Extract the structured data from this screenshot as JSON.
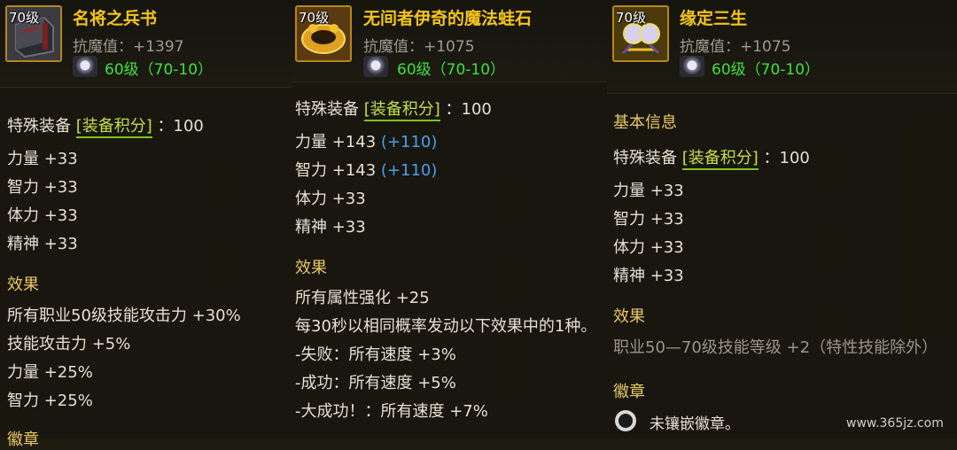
{
  "panels": [
    {
      "level": "70级",
      "title": "名将之兵书",
      "resist": "抗魔值：+1397",
      "requirement": "60级（70-10）",
      "special_label": "特殊装备",
      "score_label": "[装备积分]",
      "score_value": "：100",
      "stats": [
        "力量 +33",
        "智力 +33",
        "体力 +33",
        "精神 +33"
      ],
      "effects_heading": "效果",
      "effects": [
        "所有职业50级技能攻击力 +30%",
        "技能攻击力 +5%",
        "力量 +25%",
        "智力 +25%"
      ],
      "emblem_heading": "徽章"
    },
    {
      "level": "70级",
      "title": "无间者伊奇的魔法蛙石",
      "resist": "抗魔值：+1075",
      "requirement": "60级（70-10）",
      "special_label": "特殊装备",
      "score_label": "[装备积分]",
      "score_value": "：100",
      "stats": [
        {
          "text": "力量 +143",
          "bonus": "(+110)"
        },
        {
          "text": "智力 +143",
          "bonus": "(+110)"
        },
        {
          "text": "体力 +33",
          "bonus": ""
        },
        {
          "text": "精神 +33",
          "bonus": ""
        }
      ],
      "effects_heading": "效果",
      "effects": [
        "所有属性强化 +25",
        "每30秒以相同概率发动以下效果中的1种。",
        "-失败：所有速度 +3%",
        "-成功：所有速度 +5%",
        "-大成功！：所有速度 +7%"
      ]
    },
    {
      "level": "70级",
      "title": "缘定三生",
      "resist": "抗魔值：+1075",
      "requirement": "60级（70-10）",
      "basic_info": "基本信息",
      "special_label": "特殊装备",
      "score_label": "[装备积分]",
      "score_value": "：100",
      "stats": [
        "力量 +33",
        "智力 +33",
        "体力 +33",
        "精神 +33"
      ],
      "effects_heading": "效果",
      "effects": [
        "职业50—70级技能等级 +2（特性技能除外）"
      ],
      "emblem_heading": "徽章",
      "emblem_text": "未镶嵌徽章。"
    }
  ],
  "watermark": "www.365jz.com",
  "colors": {
    "title": "#f5c518",
    "requirement": "#3fe03f",
    "bonus": "#4aa0ee",
    "score": "#c4df4b"
  }
}
